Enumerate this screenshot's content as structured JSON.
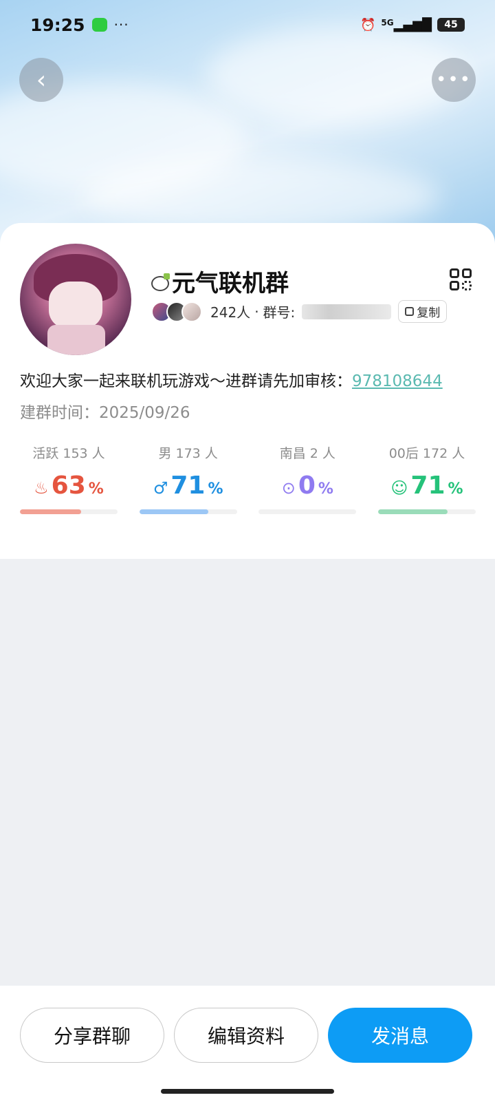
{
  "status_bar": {
    "time": "19:25",
    "more": "···",
    "signal": "5G",
    "battery": "45"
  },
  "header": {
    "back_icon": "chevron-left-icon",
    "more_icon": "more-dots-icon"
  },
  "group": {
    "name": "元气联机群",
    "member_count": "242人",
    "separator": "·",
    "id_label": "群号:",
    "copy_label": "复制",
    "description": "欢迎大家一起来联机玩游戏～进群请先加审核：",
    "description_link": "978108644",
    "created": "建群时间：2025/09/26"
  },
  "stats": [
    {
      "label": "活跃 153 人",
      "value": "63",
      "unit": "%",
      "icon": "flame-icon",
      "color": "#e5553f",
      "bar_color": "#f2a093",
      "fraction": 0.63
    },
    {
      "label": "男 173 人",
      "value": "71",
      "unit": "%",
      "icon": "male-icon",
      "color": "#1f8fe0",
      "bar_color": "#9cc7f5",
      "fraction": 0.71
    },
    {
      "label": "南昌 2 人",
      "value": "0",
      "unit": "%",
      "icon": "location-icon",
      "color": "#8f7bf0",
      "bar_color": "#c9bff7",
      "fraction": 0.0
    },
    {
      "label": "00后 172 人",
      "value": "71",
      "unit": "%",
      "icon": "person-icon",
      "color": "#25c27a",
      "bar_color": "#9adcb9",
      "fraction": 0.71
    }
  ],
  "actions": {
    "share": "分享群聊",
    "edit": "编辑资料",
    "message": "发消息"
  },
  "colors": {
    "primary": "#0d9cf5",
    "link": "#5ab9b0"
  }
}
